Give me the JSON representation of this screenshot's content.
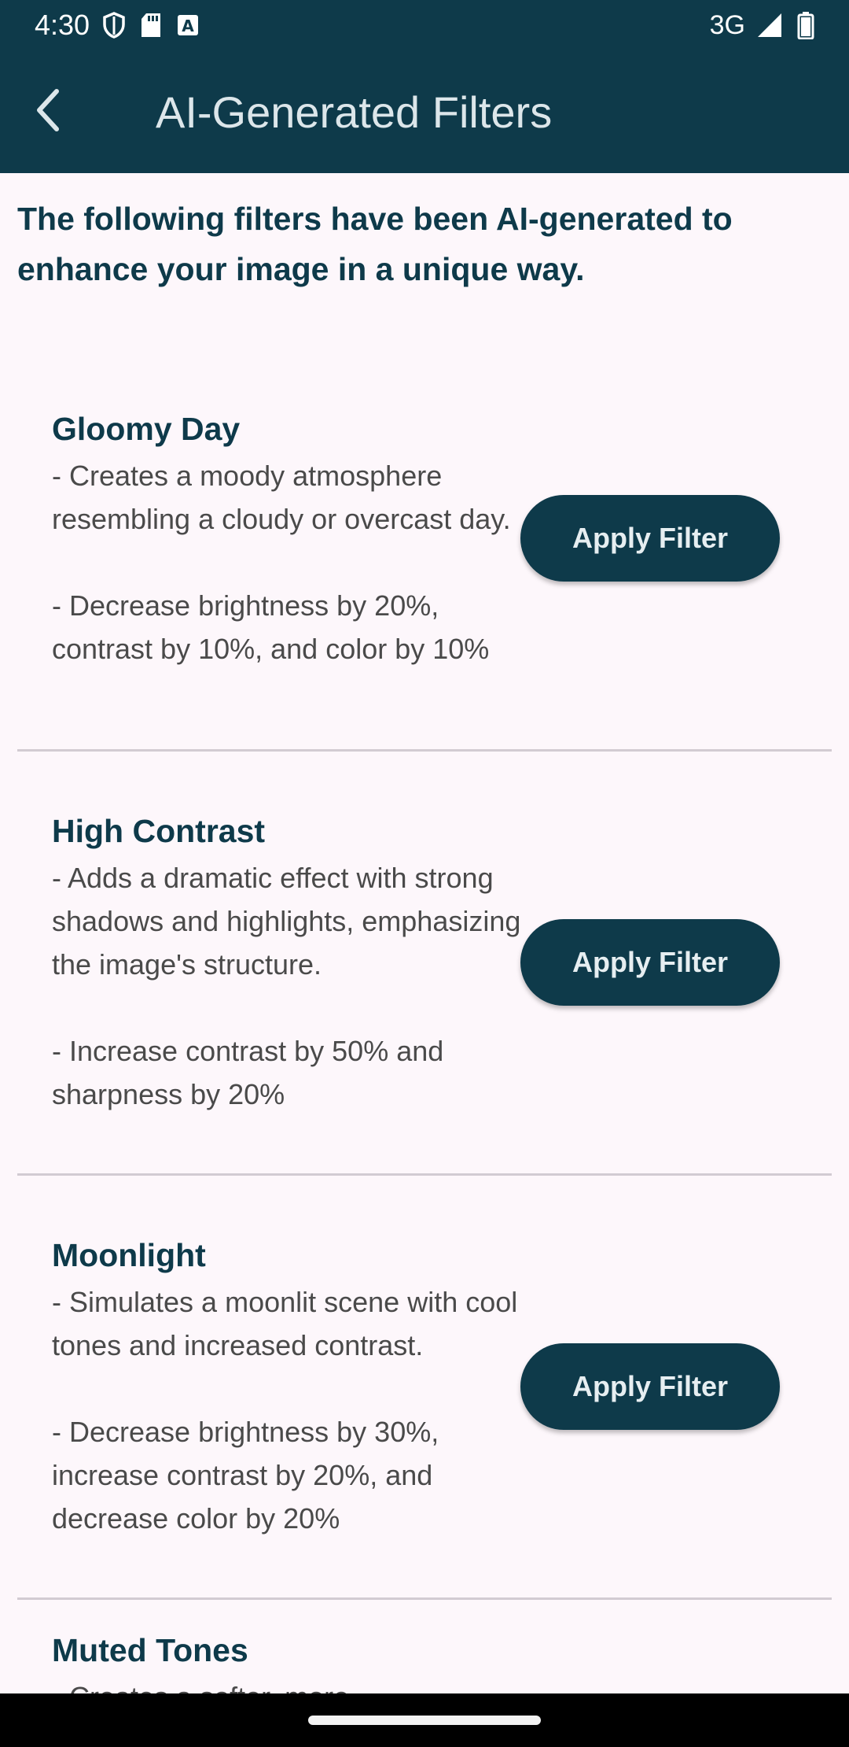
{
  "status": {
    "time": "4:30",
    "network": "3G",
    "icons": [
      "shield-icon",
      "sd-card-icon",
      "text-a-icon",
      "signal-icon",
      "battery-icon"
    ]
  },
  "app_bar": {
    "back_icon": "chevron-left-icon",
    "title": "AI-Generated Filters"
  },
  "intro": "The following filters have been AI-generated to enhance your image in a unique way.",
  "filters": [
    {
      "name": "Gloomy Day",
      "description": "- Creates a moody atmosphere resembling a cloudy or overcast day.\n\n- Decrease brightness by 20%, contrast by 10%, and color by 10%",
      "button": "Apply Filter"
    },
    {
      "name": "High Contrast",
      "description": "- Adds a dramatic effect with strong shadows and highlights, emphasizing the image's structure.\n\n- Increase contrast by 50% and sharpness by 20%",
      "button": "Apply Filter"
    },
    {
      "name": "Moonlight",
      "description": "- Simulates a moonlit scene with cool tones and increased contrast.\n\n- Decrease brightness by 30%, increase contrast by 20%, and decrease color by 20%",
      "button": "Apply Filter"
    },
    {
      "name": "Muted Tones",
      "description": "- Creates a softer, more"
    }
  ],
  "colors": {
    "primary": "#0e3a4a",
    "background": "#fdf7fb",
    "divider": "#d2cbd2"
  }
}
